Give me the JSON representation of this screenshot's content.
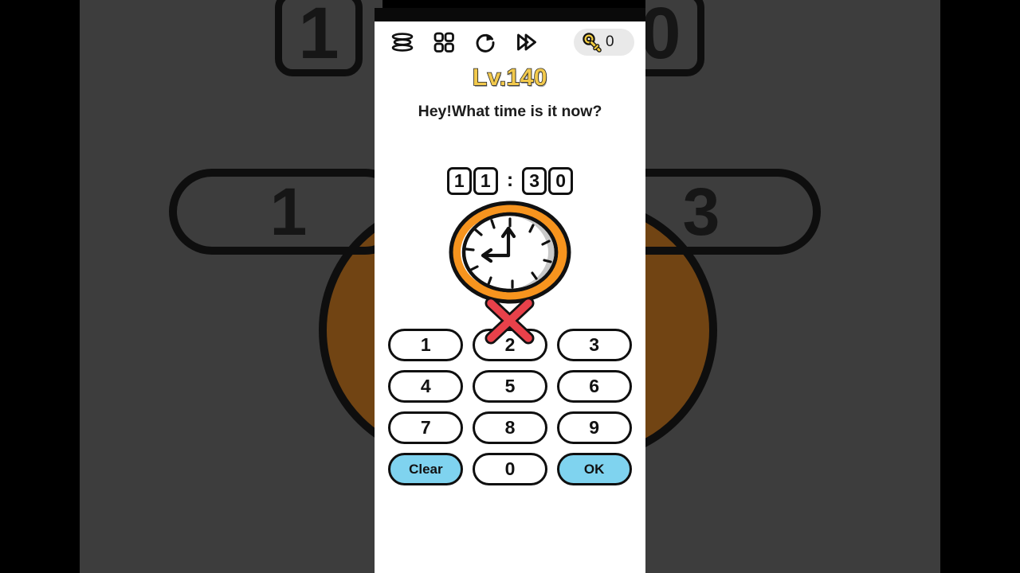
{
  "app": {
    "title": "Brain Out",
    "background_color": "#4b4b4b",
    "panel_color": "#ffffff"
  },
  "topbar": {
    "icons": [
      {
        "name": "menu-stack-icon",
        "label": "Menu"
      },
      {
        "name": "grid-levels-icon",
        "label": "Levels"
      },
      {
        "name": "restart-icon",
        "label": "Restart"
      },
      {
        "name": "skip-forward-icon",
        "label": "Skip"
      }
    ],
    "key_badge": {
      "icon": "key-icon",
      "count": "0",
      "pill_color": "#e9e9e9",
      "key_color": "#f2cc3f"
    }
  },
  "level": {
    "label": "Lv.140",
    "text_color": "#f2c94c",
    "outline_color": "#2a2a2a"
  },
  "question": {
    "text": "Hey!What time is it now?"
  },
  "time_display": {
    "digits": [
      "1",
      "1",
      "3",
      "0"
    ],
    "separator": ":",
    "value": "11:30"
  },
  "clock": {
    "rim_color": "#f7941e",
    "face_color": "#ffffff",
    "shadow_color": "#c9c9c9",
    "hand_color": "#111111",
    "hour_hand_points_to": "9",
    "minute_hand_points_to": "12",
    "displayed_time": "9:00",
    "cross_marker": {
      "name": "red-x-mark",
      "color": "#e8414a",
      "outline": "#111111"
    }
  },
  "keypad": {
    "rows": [
      [
        {
          "label": "1",
          "name": "key-1",
          "style": "number"
        },
        {
          "label": "2",
          "name": "key-2",
          "style": "number"
        },
        {
          "label": "3",
          "name": "key-3",
          "style": "number"
        }
      ],
      [
        {
          "label": "4",
          "name": "key-4",
          "style": "number"
        },
        {
          "label": "5",
          "name": "key-5",
          "style": "number"
        },
        {
          "label": "6",
          "name": "key-6",
          "style": "number"
        }
      ],
      [
        {
          "label": "7",
          "name": "key-7",
          "style": "number"
        },
        {
          "label": "8",
          "name": "key-8",
          "style": "number"
        },
        {
          "label": "9",
          "name": "key-9",
          "style": "number"
        }
      ],
      [
        {
          "label": "Clear",
          "name": "key-clear",
          "style": "action"
        },
        {
          "label": "0",
          "name": "key-0",
          "style": "number"
        },
        {
          "label": "OK",
          "name": "key-ok",
          "style": "action"
        }
      ]
    ],
    "action_color": "#7fd3ef"
  },
  "background_preview": {
    "left": {
      "top_key": "1",
      "bottom_key": "1"
    },
    "right": {
      "top_key": "0",
      "bottom_key": "3"
    }
  }
}
